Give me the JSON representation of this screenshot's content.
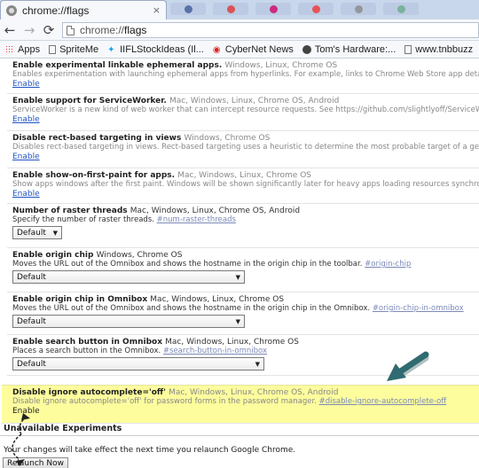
{
  "tab": {
    "title": "chrome://flags",
    "close": "×"
  },
  "toolbar": {
    "back": "←",
    "forward": "→",
    "reload": "⟳",
    "url_prefix": "chrome://",
    "url_path": "flags"
  },
  "bookmarks": [
    {
      "label": "Apps",
      "icon": "apps-icon"
    },
    {
      "label": "SpriteMe",
      "icon": "page-icon"
    },
    {
      "label": "IIFLStockIdeas (Il...",
      "icon": "twitter-icon"
    },
    {
      "label": "CyberNet News",
      "icon": "cybernet-icon"
    },
    {
      "label": "Tom's Hardware:...",
      "icon": "toms-hardware-icon"
    },
    {
      "label": "www.tnbbuzz",
      "icon": "page-icon"
    }
  ],
  "experiments": [
    {
      "title": "Enable experimental linkable ephemeral apps.",
      "platforms": "Windows, Linux, Chrome OS",
      "desc": "Enables experimentation with launching ephemeral apps from hyperlinks. For example, links to Chrome Web Store app detail pag",
      "hash": "",
      "action": "Enable"
    },
    {
      "title": "Enable support for ServiceWorker.",
      "platforms": "Mac, Windows, Linux, Chrome OS, Android",
      "desc": "ServiceWorker is a new kind of web worker that can intercept resource requests. See https://github.com/slightlyoff/ServiceWorker",
      "hash": "",
      "action": "Enable"
    },
    {
      "title": "Disable rect-based targeting in views",
      "platforms": "Windows, Chrome OS",
      "desc": "Disables rect-based targeting in views. Rect-based targeting uses a heuristic to determine the most probable target of a gesture, w",
      "hash": "",
      "action": "Enable"
    },
    {
      "title": "Enable show-on-first-paint for apps.",
      "platforms": "Mac, Windows, Linux, Chrome OS",
      "desc": "Show apps windows after the first paint. Windows will be shown significantly later for heavy apps loading resources synchronous",
      "hash": "",
      "action": "Enable"
    },
    {
      "title": "Number of raster threads",
      "platforms": "Mac, Windows, Linux, Chrome OS, Android",
      "desc": "Specify the number of raster threads.",
      "hash": "#num-raster-threads",
      "select": "Default"
    },
    {
      "title": "Enable origin chip",
      "platforms": "Windows, Chrome OS",
      "desc": "Moves the URL out of the Omnibox and shows the hostname in the origin chip in the toolbar.",
      "hash": "#origin-chip",
      "select": "Default"
    },
    {
      "title": "Enable origin chip in Omnibox",
      "platforms": "Mac, Windows, Linux, Chrome OS",
      "desc": "Moves the URL out of the Omnibox and shows the hostname in the origin chip in the Omnibox.",
      "hash": "#origin-chip-in-omnibox",
      "select": "Default"
    },
    {
      "title": "Enable search button in Omnibox",
      "platforms": "Mac, Windows, Linux, Chrome OS",
      "desc": "Places a search button in the Omnibox.",
      "hash": "#search-button-in-omnibox",
      "select": "Default"
    },
    {
      "title": "Disable ignore autocomplete='off'",
      "platforms": "Mac, Windows, Linux, Chrome OS, Android",
      "desc": "Disable ignore autocomplete='off' for password forms in the password manager.",
      "hash": "#disable-ignore-autocomplete-off",
      "action": "Enable"
    }
  ],
  "footer": {
    "heading": "Unavailable Experiments",
    "notice": "Your changes will take effect the next time you relaunch Google Chrome.",
    "relaunch": "Relaunch Now"
  },
  "colors": {
    "highlight": "#fdfd9e",
    "link": "#1f53c4",
    "annotation_arrow": "#2f6b70"
  }
}
